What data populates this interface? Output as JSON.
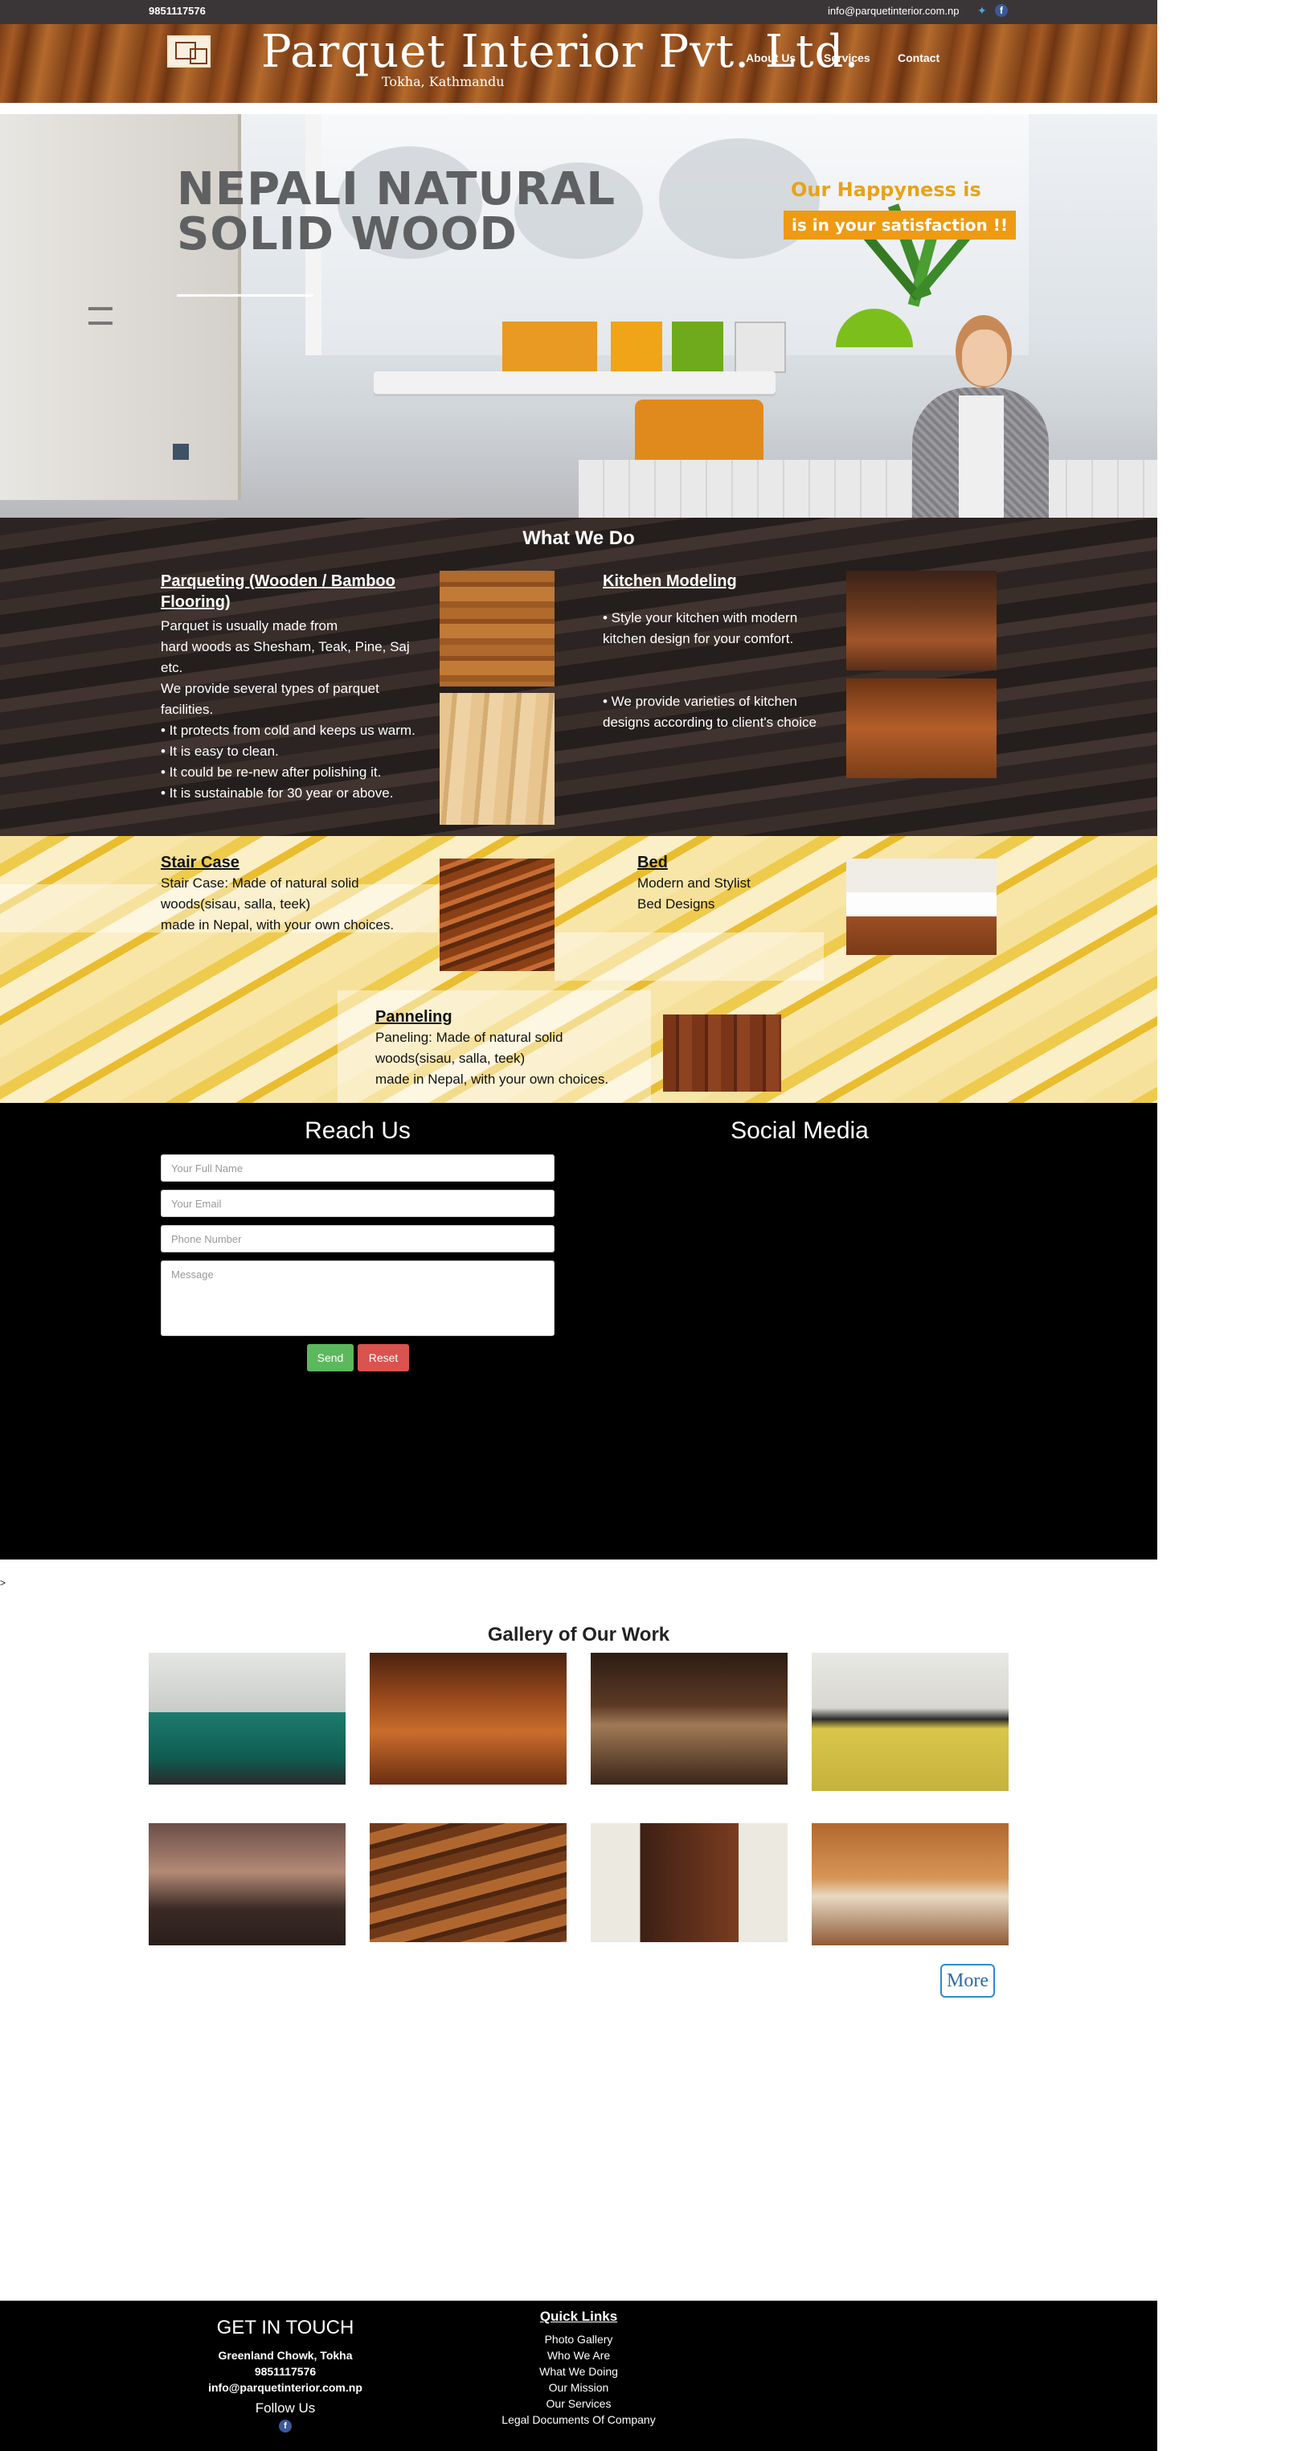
{
  "topbar": {
    "phone": "9851117576",
    "email": "info@parquetinterior.com.np",
    "twitter_icon": "twitter-icon",
    "facebook_icon": "facebook-icon"
  },
  "header": {
    "brand": "Parquet Interior Pvt. Ltd.",
    "subtitle": "Tokha, Kathmandu",
    "nav": [
      "About Us",
      "Services",
      "Contact"
    ]
  },
  "hero": {
    "title_line1": "NEPALI NATURAL",
    "title_line2": "SOLID WOOD",
    "tagline1": "Our Happyness is",
    "tagline2": "is in your satisfaction !!"
  },
  "what_we_do": {
    "heading": "What We Do",
    "parqueting": {
      "title": "Parqueting (Wooden / Bamboo Flooring)",
      "text": "Parquet is usually made from\nhard woods as Shesham, Teak, Pine, Saj etc.\nWe provide several types of parquet facilities.\n• It protects from cold and keeps us warm.\n• It is easy to clean.\n• It could be re-new after polishing it.\n• It is sustainable for 30 year or above."
    },
    "kitchen": {
      "title": "Kitchen Modeling",
      "text1": "• Style your kitchen with   modern kitchen design  for your comfort.",
      "text2": "• We provide varieties of kitchen designs according to client's choice"
    }
  },
  "products": {
    "staircase": {
      "title": "Stair Case",
      "text": "Stair Case: Made of natural solid\nwoods(sisau, salla, teek)\nmade in Nepal, with your own choices."
    },
    "bed": {
      "title": "Bed",
      "text": "Modern and Stylist\nBed Designs"
    },
    "panneling": {
      "title": "Panneling",
      "text": "Paneling: Made of natural solid\nwoods(sisau, salla, teek)\nmade in Nepal, with your own choices."
    }
  },
  "reach_us": {
    "heading": "Reach Us",
    "social_heading": "Social Media",
    "name_placeholder": "Your  Full Name",
    "email_placeholder": "Your  Email",
    "phone_placeholder": "Phone Number",
    "message_placeholder": "Message",
    "send_label": "Send",
    "reset_label": "Reset"
  },
  "stray_text": ">",
  "gallery": {
    "heading": "Gallery of Our Work",
    "more_label": "More"
  },
  "footer": {
    "get_in_touch": "GET IN TOUCH",
    "address": "Greenland Chowk, Tokha",
    "phone": "9851117576",
    "email": "info@parquetinterior.com.np",
    "follow_us": "Follow Us",
    "quick_links_heading": "Quick Links",
    "quick_links": [
      "Photo Gallery",
      "Who We Are",
      "What We Doing",
      "Our Mission",
      "Our Services",
      "Legal Documents Of Company"
    ]
  },
  "colors": {
    "accent_orange": "#ee9a12",
    "send_green": "#5cb85c",
    "reset_red": "#d9534f",
    "dark_bar": "#3a3637"
  }
}
